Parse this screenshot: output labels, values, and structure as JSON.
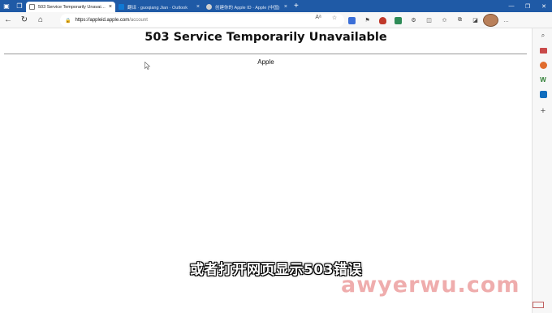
{
  "browser": {
    "tabs": [
      {
        "label": "503 Service Temporarily Unavaila...",
        "active": true
      },
      {
        "label": "翻译 · guoqiang Jian · Outlook",
        "active": false
      },
      {
        "label": "创建你的 Apple ID · Apple (中国)",
        "active": false
      }
    ],
    "close_glyph": "×",
    "new_tab": "+",
    "address": {
      "lock": "🔒",
      "host": "https://appleid.apple.com",
      "rest": "/account"
    }
  },
  "page": {
    "heading": "503 Service Temporarily Unavailable",
    "server": "Apple"
  },
  "overlay": {
    "subtitle": "或者打开网页显示503错误",
    "watermark": "awyerwu.com"
  },
  "colors": {
    "tabstrip": "#1f5aa6",
    "toolbar": "#f7f7f7"
  },
  "icons": {
    "sidebar": [
      "search-icon",
      "briefcase-icon",
      "outlook-icon",
      "office-icon",
      "outlook-mail-icon",
      "add-icon"
    ]
  }
}
